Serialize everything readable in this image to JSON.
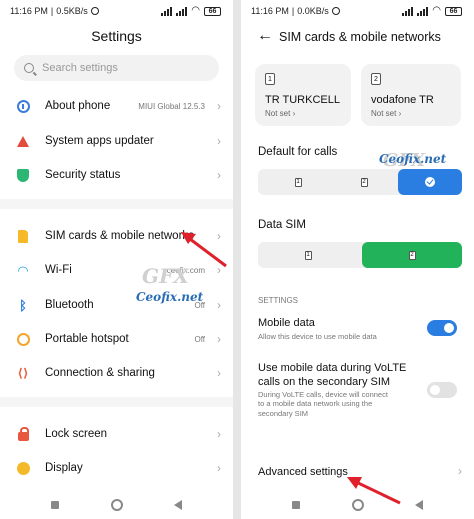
{
  "status": {
    "left": {
      "time": "11:16 PM",
      "speed": "0.5KB/s"
    },
    "right": {
      "time": "11:16 PM",
      "speed": "0.0KB/s"
    },
    "battery": "66"
  },
  "settings_screen": {
    "title": "Settings",
    "search": {
      "placeholder": "Search settings"
    },
    "items": [
      {
        "label": "About phone",
        "value": "MIUI Global 12.5.3",
        "icon": "info-icon"
      },
      {
        "label": "System apps updater",
        "value": "",
        "icon": "up-arrow-icon"
      },
      {
        "label": "Security status",
        "value": "",
        "icon": "shield-icon"
      },
      {
        "label": "SIM cards & mobile networks",
        "value": "",
        "icon": "sim-icon"
      },
      {
        "label": "Wi-Fi",
        "value": "ceofix.com",
        "icon": "wifi-icon"
      },
      {
        "label": "Bluetooth",
        "value": "Off",
        "icon": "bluetooth-icon"
      },
      {
        "label": "Portable hotspot",
        "value": "Off",
        "icon": "hotspot-icon"
      },
      {
        "label": "Connection & sharing",
        "value": "",
        "icon": "connection-icon"
      },
      {
        "label": "Lock screen",
        "value": "",
        "icon": "lock-icon"
      },
      {
        "label": "Display",
        "value": "",
        "icon": "display-icon"
      }
    ]
  },
  "sim_screen": {
    "title": "SIM cards & mobile networks",
    "sims": [
      {
        "slot": "1",
        "name": "TR TURKCELL",
        "status": "Not set"
      },
      {
        "slot": "2",
        "name": "vodafone TR",
        "status": "Not set"
      }
    ],
    "default_calls": {
      "label": "Default for calls",
      "options": [
        "1",
        "2"
      ]
    },
    "data_sim": {
      "label": "Data SIM",
      "options": [
        "1",
        "2"
      ]
    },
    "section_header": "SETTINGS",
    "mobile_data": {
      "title": "Mobile data",
      "desc": "Allow this device to use mobile data",
      "enabled": true
    },
    "volte": {
      "title_line1": "Use mobile data during VoLTE",
      "title_line2": "calls on the secondary SIM",
      "desc_line1": "During VoLTE calls, device will connect",
      "desc_line2": "to a mobile data network using the",
      "desc_line3": "secondary SIM",
      "enabled": false
    },
    "advanced": "Advanced settings"
  },
  "watermarks": {
    "brand_short": "GFX",
    "brand_name": "Ceofix.net"
  },
  "colors": {
    "accent_blue": "#2a7de1",
    "accent_green": "#22b35a",
    "arrow_red": "#e0202a"
  }
}
